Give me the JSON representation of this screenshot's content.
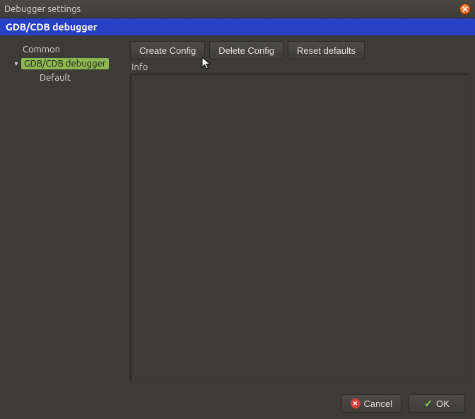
{
  "window": {
    "title": "Debugger settings"
  },
  "header": {
    "title": "GDB/CDB debugger"
  },
  "tree": {
    "items": [
      {
        "label": "Common"
      },
      {
        "label": "GDB/CDB debugger"
      },
      {
        "label": "Default"
      }
    ]
  },
  "toolbar": {
    "create_label": "Create Config",
    "delete_label": "Delete Config",
    "reset_label": "Reset defaults"
  },
  "info": {
    "label": "Info"
  },
  "footer": {
    "cancel_label": "Cancel",
    "ok_label": "OK"
  }
}
